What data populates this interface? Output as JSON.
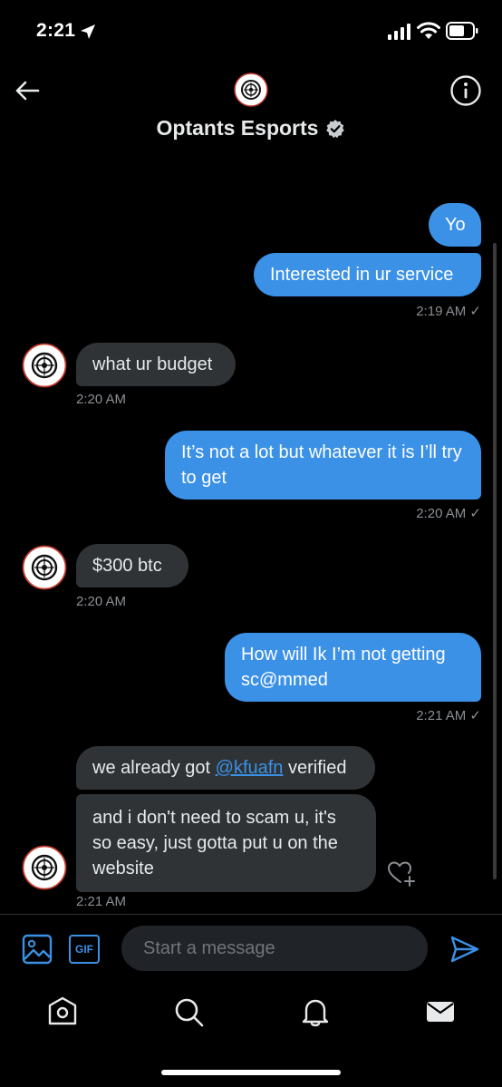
{
  "status_bar": {
    "time": "2:21"
  },
  "header": {
    "title": "Optants Esports",
    "back_icon": "arrow-left-icon",
    "info_icon": "info-icon"
  },
  "messages": [
    {
      "side": "sent",
      "text": "Yo"
    },
    {
      "side": "sent",
      "text": "Interested in ur service",
      "timestamp": "2:19 AM ✓"
    },
    {
      "side": "received",
      "text": "what ur budget",
      "timestamp": "2:20 AM"
    },
    {
      "side": "sent",
      "text": "It’s not a lot but whatever it is I’ll try to get",
      "timestamp": "2:20 AM ✓"
    },
    {
      "side": "received",
      "text": "$300 btc",
      "timestamp": "2:20 AM"
    },
    {
      "side": "sent",
      "text": "How will Ik I’m not getting sc@mmed",
      "timestamp": "2:21 AM ✓"
    },
    {
      "side": "received",
      "text_before": "we already got ",
      "mention": "@kfuafn",
      "text_after": " verified"
    },
    {
      "side": "received",
      "text": "and i don't need to scam u, it's so easy, just gotta put u on the website",
      "timestamp": "2:21 AM"
    }
  ],
  "composer": {
    "placeholder": "Start a message",
    "gif_label": "GIF"
  },
  "tabs": [
    "home-icon",
    "search-icon",
    "notifications-icon",
    "messages-icon"
  ],
  "colors": {
    "background": "#000000",
    "sent_bubble": "#3b91e6",
    "received_bubble": "#2f3336",
    "accent": "#3b91e6",
    "timestamp": "#8b8f94"
  }
}
